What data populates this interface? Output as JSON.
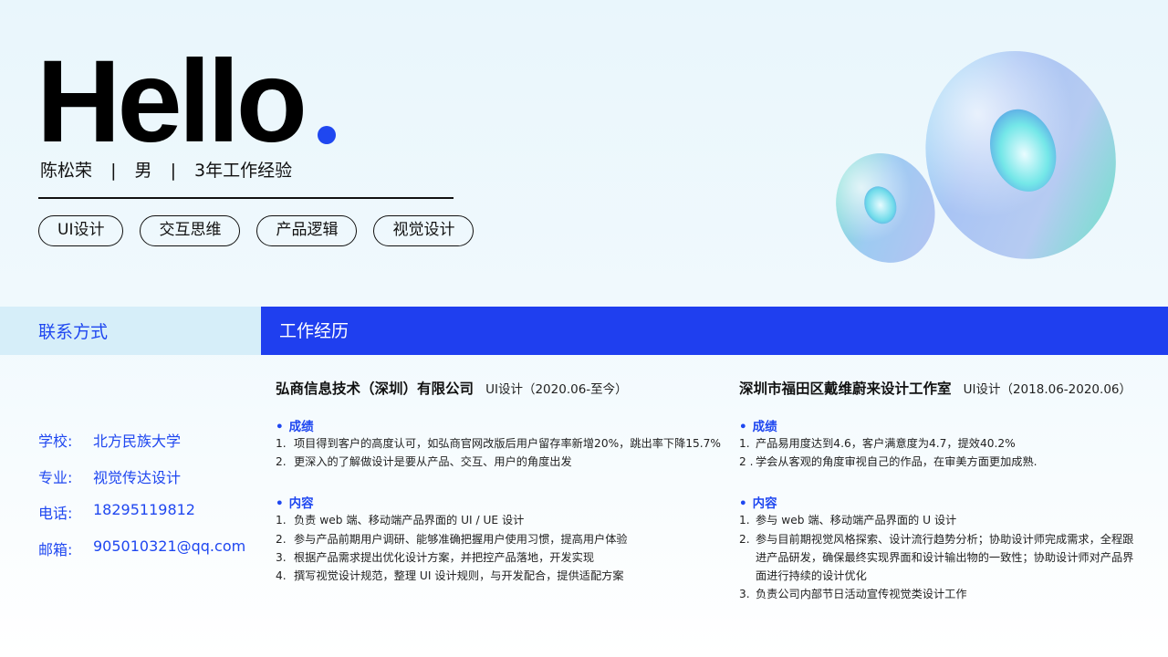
{
  "hero": {
    "hello": "Hello",
    "name": "陈松荣",
    "gender": "男",
    "experience": "3年工作经验",
    "separator": "|",
    "tags": [
      "UI设计",
      "交互思维",
      "产品逻辑",
      "视觉设计"
    ]
  },
  "sections": {
    "contact_title": "联系方式",
    "work_title": "工作经历"
  },
  "contact": {
    "school_label": "学校:",
    "school": "北方民族大学",
    "major_label": "专业:",
    "major": "视觉传达设计",
    "phone_label": "电话:",
    "phone": "18295119812",
    "email_label": "邮箱:",
    "email": "905010321@qq.com"
  },
  "jobs": [
    {
      "company": "弘商信息技术（深圳）有限公司",
      "role": "UI设计（2020.06-至今）",
      "achievements_title": "成绩",
      "achievements": [
        {
          "n": "1.",
          "t": "项目得到客户的高度认可，如弘商官网改版后用户留存率新增20%，跳出率下降15.7%"
        },
        {
          "n": "2.",
          "t": "更深入的了解做设计是要从产品、交互、用户的角度出发"
        }
      ],
      "content_title": "内容",
      "content": [
        {
          "n": "1.",
          "t": "负责 web 端、移动端产品界面的 UI / UE 设计"
        },
        {
          "n": "2.",
          "t": "参与产品前期用户调研、能够准确把握用户使用习惯，提高用户体验"
        },
        {
          "n": "3.",
          "t": "根据产品需求提出优化设计方案，并把控产品落地，开发实现"
        },
        {
          "n": "4.",
          "t": "撰写视觉设计规范，整理 UI 设计规则，与开发配合，提供适配方案"
        }
      ]
    },
    {
      "company": "深圳市福田区戴维蔚来设计工作室",
      "role": "UI设计（2018.06-2020.06）",
      "achievements_title": "成绩",
      "achievements": [
        {
          "n": "1.",
          "t": "产品易用度达到4.6，客户满意度为4.7，提效40.2%"
        },
        {
          "n": "2 .",
          "t": "学会从客观的角度审视自己的作品，在审美方面更加成熟."
        }
      ],
      "content_title": "内容",
      "content": [
        {
          "n": "1.",
          "t": "参与 web 端、移动端产品界面的 U 设计"
        },
        {
          "n": "2.",
          "t": "参与目前期视觉风格探索、设计流行趋势分析；协助设计师完成需求，全程跟进产品研发，确保最终实现界面和设计输出物的一致性；协助设计师对产品界面进行持续的设计优化"
        },
        {
          "n": "3.",
          "t": "负责公司内部节日活动宣传视觉类设计工作"
        }
      ]
    }
  ],
  "colors": {
    "accent": "#1f47f0",
    "bar_blue": "#1f3fef",
    "bar_light": "#d6eef9",
    "text": "#111111"
  },
  "icons": {
    "decoration": "3d-torus-rings",
    "bullet": "blue-dot-bullet",
    "hello_dot": "blue-dot"
  }
}
